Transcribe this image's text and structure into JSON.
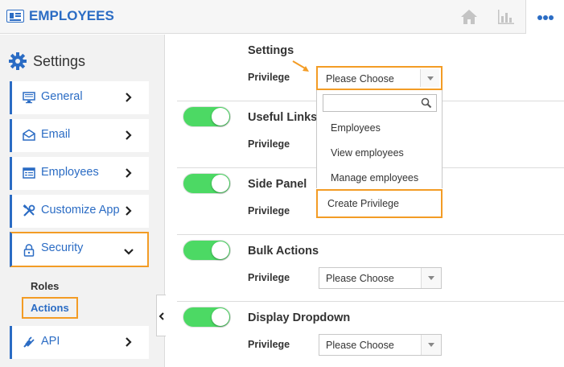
{
  "app": {
    "title": "EMPLOYEES",
    "icon": "id-card-icon"
  },
  "header": {
    "home_icon": "home-icon",
    "chart_icon": "bar-chart-icon",
    "more_icon": "more-dots-icon"
  },
  "sidebar": {
    "title": "Settings",
    "title_icon": "gear-icon",
    "items": [
      {
        "label": "General",
        "icon": "monitor-icon"
      },
      {
        "label": "Email",
        "icon": "envelope-icon"
      },
      {
        "label": "Employees",
        "icon": "list-icon"
      },
      {
        "label": "Customize App",
        "icon": "tools-icon"
      },
      {
        "label": "Security",
        "icon": "lock-icon"
      },
      {
        "label": "API",
        "icon": "plug-icon"
      }
    ],
    "subitems": [
      {
        "label": "Roles"
      },
      {
        "label": "Actions"
      }
    ]
  },
  "main": {
    "sections": [
      {
        "title": "Settings",
        "privilege_label": "Privilege",
        "value": "Please Choose"
      },
      {
        "title": "Useful Links",
        "privilege_label": "Privilege",
        "value": ""
      },
      {
        "title": "Side Panel",
        "privilege_label": "Privilege",
        "value": ""
      },
      {
        "title": "Bulk Actions",
        "privilege_label": "Privilege",
        "value": "Please Choose"
      },
      {
        "title": "Display Dropdown",
        "privilege_label": "Privilege",
        "value": "Please Choose"
      }
    ],
    "dropdown": {
      "search_placeholder": "",
      "options": [
        "Employees",
        "View employees",
        "Manage employees"
      ],
      "create_label": "Create Privilege"
    }
  },
  "colors": {
    "accent": "#2b6cc4",
    "highlight": "#f39c25",
    "toggle_on": "#4cd964"
  }
}
